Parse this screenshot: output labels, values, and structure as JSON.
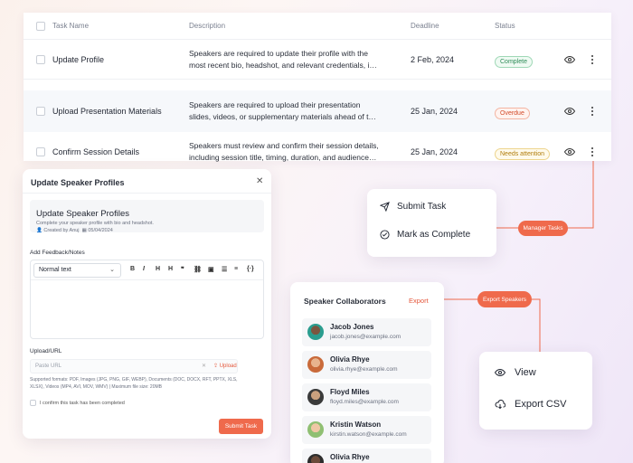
{
  "table": {
    "headers": {
      "name": "Task Name",
      "description": "Description",
      "deadline": "Deadline",
      "status": "Status"
    },
    "rows": [
      {
        "name": "Update Profile",
        "desc1": "Speakers are required to update their profile with the",
        "desc2": "most recent bio, headshot, and relevant credentials, i…",
        "deadline": "2 Feb, 2024",
        "status": "Complete"
      },
      {
        "name": "Upload Presentation Materials",
        "desc1": "Speakers are required to upload their presentation",
        "desc2": "slides, videos, or supplementary materials ahead of t…",
        "deadline": "25 Jan, 2024",
        "status": "Overdue"
      },
      {
        "name": "Confirm Session Details",
        "desc1": "Speakers must review and confirm their session details,",
        "desc2": "including session title, timing, duration, and audience…",
        "deadline": "25 Jan, 2024",
        "status": "Needs attention"
      }
    ]
  },
  "modal": {
    "title": "Update Speaker Profiles",
    "info_title": "Update Speaker Profiles",
    "info_sub": "Complete your speaker profile with bio and headshot.",
    "created_by": "Created by Anuj",
    "created_date": "05/04/2024",
    "feedback_label": "Add Feedback/Notes",
    "format_value": "Normal text",
    "upload_label": "Upload/URL",
    "upload_placeholder": "Paste URL",
    "upload_button": "Upload",
    "upload_note": "Supported formats: PDF, Images (JPG, PNG, GIF, WEBP), Documents (DOC, DOCX, RFT, PPTX, XLS, XLSX), Videos (MP4, AVI, MOV, WMV) | Maximum file size: 20MB",
    "confirm_text": "I confirm this task has been completed",
    "submit": "Submit Task"
  },
  "actions": {
    "submit": "Submit Task",
    "complete": "Mark as Complete"
  },
  "tags": {
    "manager": "Manager Tasks",
    "export": "Export Speakers"
  },
  "collaborators": {
    "title": "Speaker Collaborators",
    "export": "Export",
    "people": [
      {
        "name": "Jacob Jones",
        "email": "jacob.jones@example.com"
      },
      {
        "name": "Olivia Rhye",
        "email": "olivia.rhye@example.com"
      },
      {
        "name": "Floyd Miles",
        "email": "floyd.miles@example.com"
      },
      {
        "name": "Kristin Watson",
        "email": "kirstin.watson@example.com"
      },
      {
        "name": "Olivia Rhye",
        "email": ""
      }
    ]
  },
  "view_menu": {
    "view": "View",
    "export": "Export CSV"
  },
  "colors": {
    "accent": "#ef6a4c",
    "complete": "#2e8b57",
    "overdue": "#d24b2a",
    "attention": "#b07c0a"
  }
}
